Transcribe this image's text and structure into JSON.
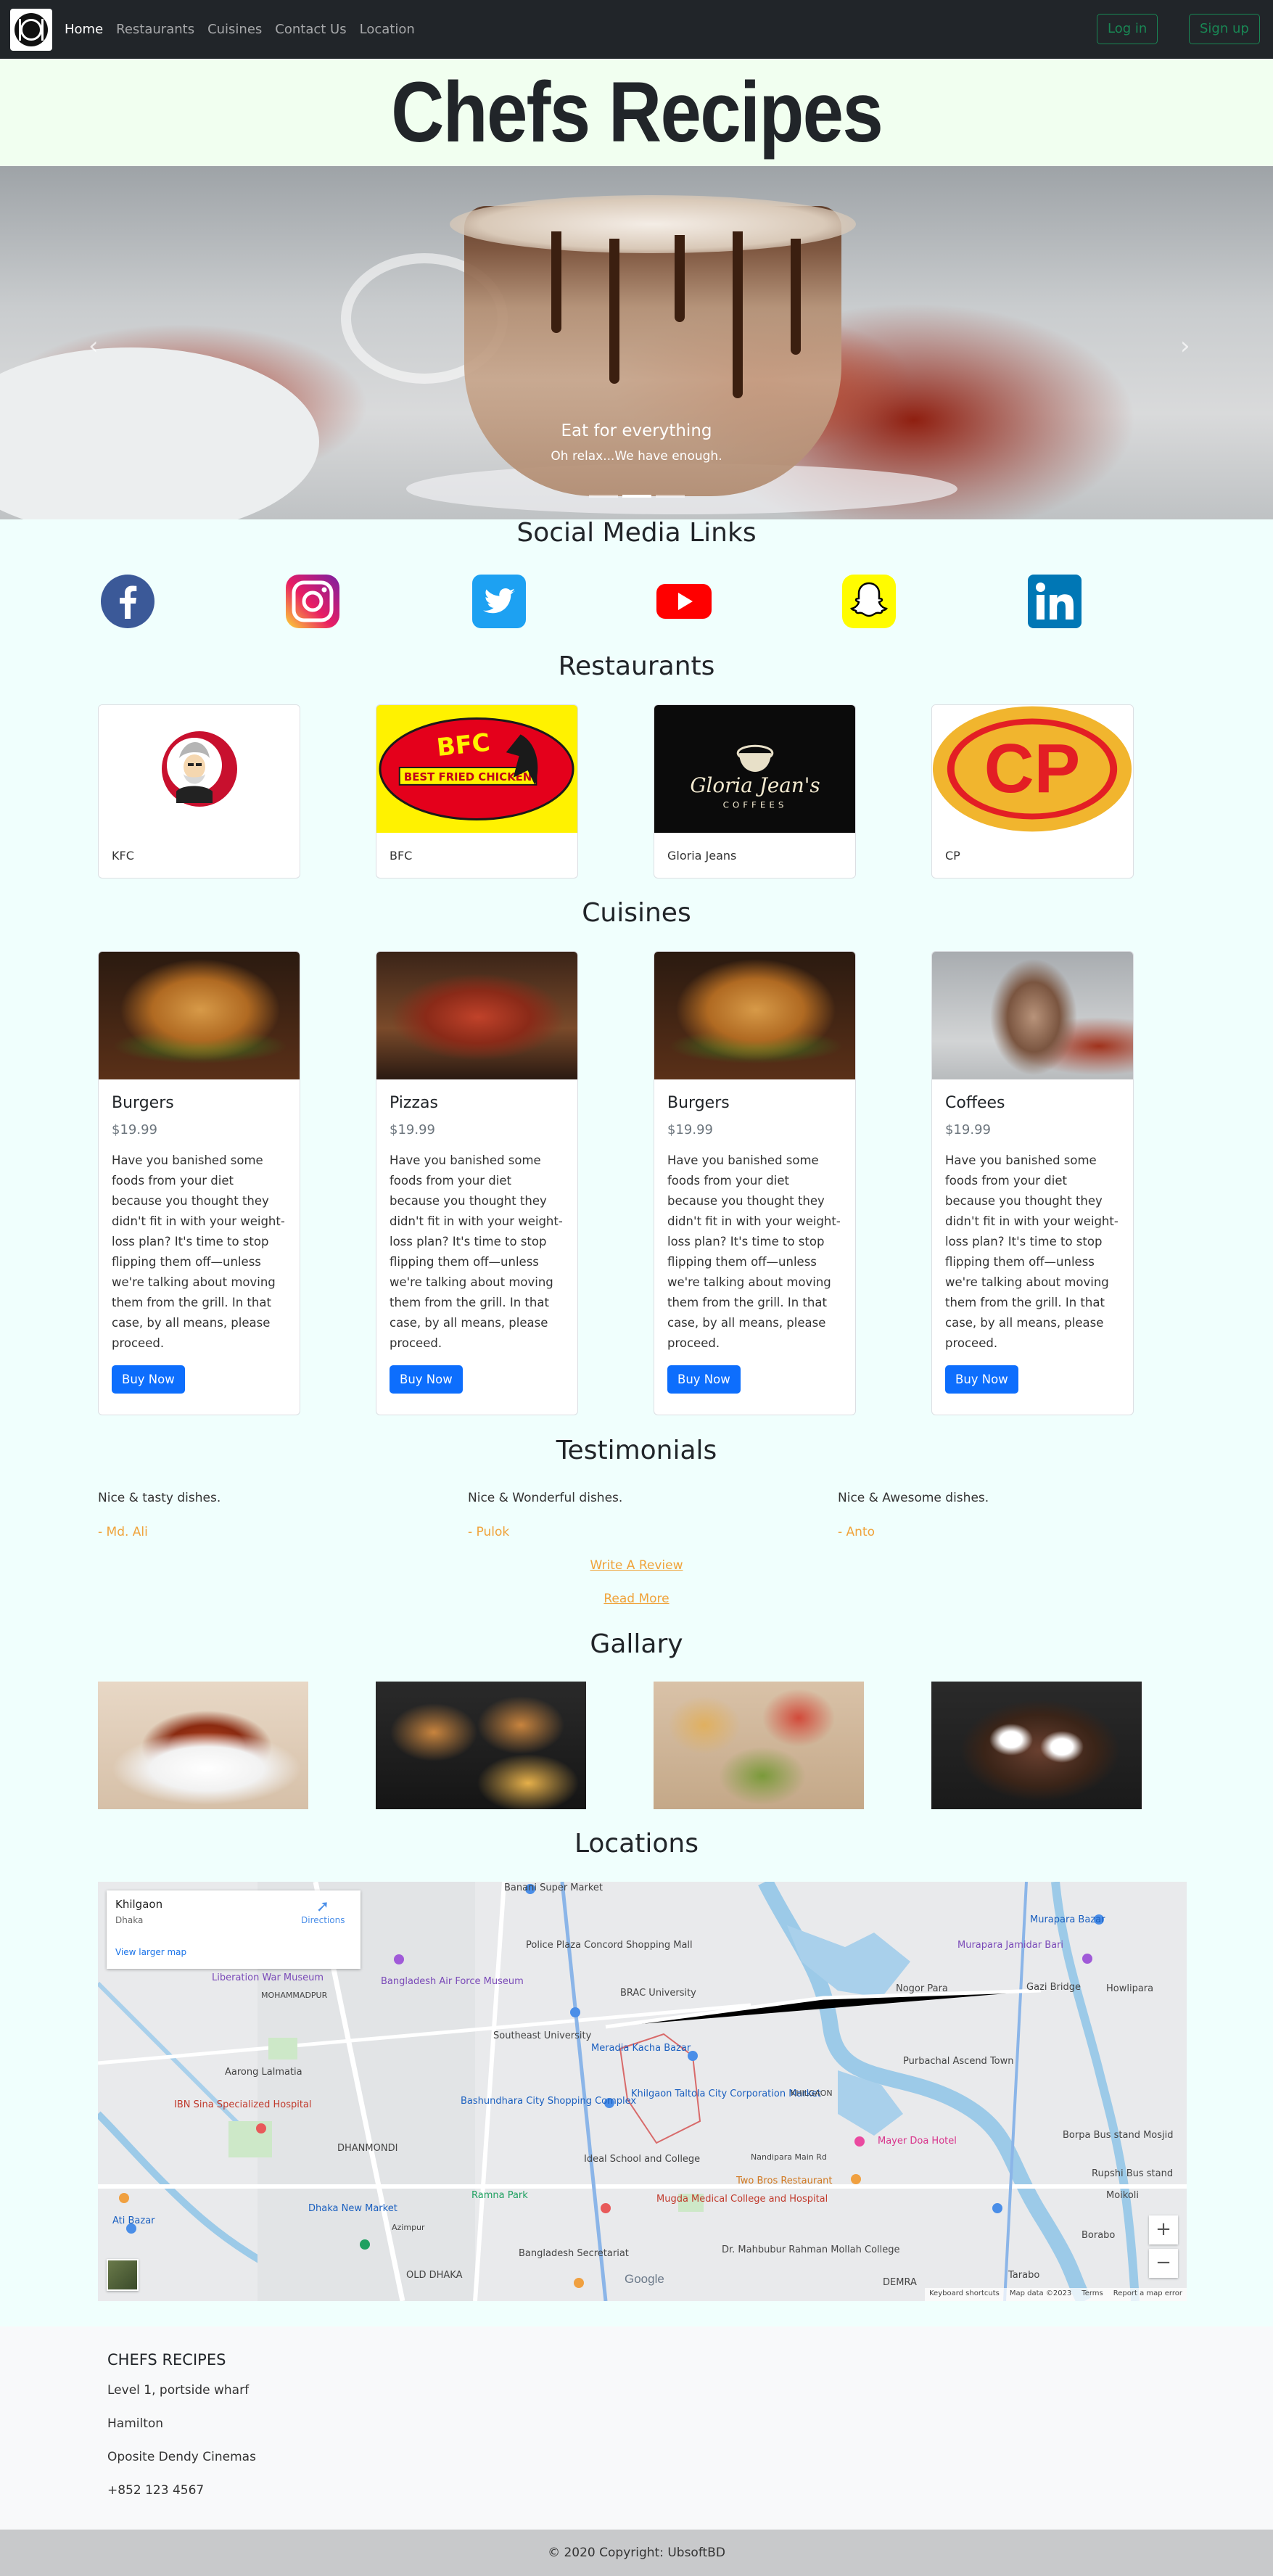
{
  "nav": {
    "links": [
      "Home",
      "Restaurants",
      "Cuisines",
      "Contact Us",
      "Location"
    ],
    "login": "Log in",
    "signup": "Sign up"
  },
  "header": {
    "title": "Chefs Recipes"
  },
  "carousel": {
    "caption_title": "Eat for everything",
    "caption_text": "Oh relax...We have enough.",
    "prev_icon": "chevron-left-icon",
    "next_icon": "chevron-right-icon",
    "slide_count": 3,
    "active_slide": 2
  },
  "social": {
    "title": "Social Media Links",
    "icons": [
      "facebook-icon",
      "instagram-icon",
      "twitter-icon",
      "youtube-icon",
      "snapchat-icon",
      "linkedin-icon"
    ]
  },
  "restaurants": {
    "title": "Restaurants",
    "items": [
      {
        "name": "KFC",
        "logo": "kfc-logo"
      },
      {
        "name": "BFC",
        "logo": "bfc-logo",
        "logo_text": "BEST FRIED CHICKEN"
      },
      {
        "name": "Gloria Jeans",
        "logo": "gloria-jeans-logo",
        "logo_text": "Gloria Jean's",
        "logo_subtext": "COFFEES"
      },
      {
        "name": "CP",
        "logo": "cp-logo",
        "logo_text": "CP"
      }
    ]
  },
  "cuisines": {
    "title": "Cuisines",
    "description": "Have you banished some foods from your diet because you thought they didn't fit in with your weight-loss plan? It's time to stop flipping them off—unless we're talking about moving them from the grill. In that case, by all means, please proceed.",
    "button": "Buy Now",
    "items": [
      {
        "name": "Burgers",
        "price": "$19.99"
      },
      {
        "name": "Pizzas",
        "price": "$19.99"
      },
      {
        "name": "Burgers",
        "price": "$19.99"
      },
      {
        "name": "Coffees",
        "price": "$19.99"
      }
    ]
  },
  "testimonials": {
    "title": "Testimonials",
    "items": [
      {
        "text": "Nice & tasty dishes.",
        "author": "- Md. Ali"
      },
      {
        "text": "Nice & Wonderful dishes.",
        "author": "- Pulok"
      },
      {
        "text": "Nice & Awesome dishes.",
        "author": "- Anto"
      }
    ],
    "write_review": "Write A Review",
    "read_more": "Read More"
  },
  "gallery": {
    "title": "Gallary"
  },
  "locations": {
    "title": "Locations",
    "place_name": "Khilgaon",
    "place_sub": "Dhaka",
    "directions": "Directions",
    "larger_map": "View larger map",
    "labels": [
      "Banani Super Market",
      "Police Plaza Concord Shopping Mall",
      "BRAC University",
      "Liberation War Museum",
      "Bangladesh Air Force Museum",
      "Aarong Lalmatia",
      "Southeast University",
      "Meradia Kacha Bazar",
      "Khilgaon Taltola City Corporation Market",
      "Bashundhara City Shopping Complex",
      "IBN Sina Specialized Hospital",
      "Ideal School and College",
      "Two Bros Restaurant",
      "Mugda Medical College and Hospital",
      "Dhaka New Market",
      "Ramna Park",
      "Bangladesh Secretariat",
      "Mayer Doa Hotel",
      "Dr. Mahbubur Rahman Mollah College",
      "Nogor Para",
      "Purbachal Ascend Town",
      "Murapara Bazar",
      "Murapara Jamidar Bari",
      "Howlipara",
      "Gazi Bridge",
      "Borpa Bus stand Mosjid",
      "Rupshi Bus stand",
      "Moikoli",
      "Borabo",
      "Tarabo",
      "DEMRA",
      "DHANMONDI",
      "OLD DHAKA",
      "MOHAMMADPUR",
      "KHILGAON",
      "Azimpur",
      "Ati Bazar",
      "Nandipara Main Rd"
    ],
    "zoom_in": "+",
    "zoom_out": "−",
    "footer_links": [
      "Keyboard shortcuts",
      "Map data ©2023",
      "Terms",
      "Report a map error"
    ],
    "google": "Google"
  },
  "footer": {
    "title": "CHEFS RECIPES",
    "lines": [
      "Level 1, portside wharf",
      "Hamilton",
      "Oposite Dendy Cinemas",
      "+852 123 4567"
    ],
    "copyright": "© 2020 Copyright: UbsoftBD"
  },
  "colors": {
    "navbar": "#212529",
    "header_bg": "#f1fff0",
    "page_bg": "#f0fffd",
    "accent_green": "#198754",
    "buy_button": "#0d6efd",
    "testimonial_author": "#f0a33a"
  }
}
